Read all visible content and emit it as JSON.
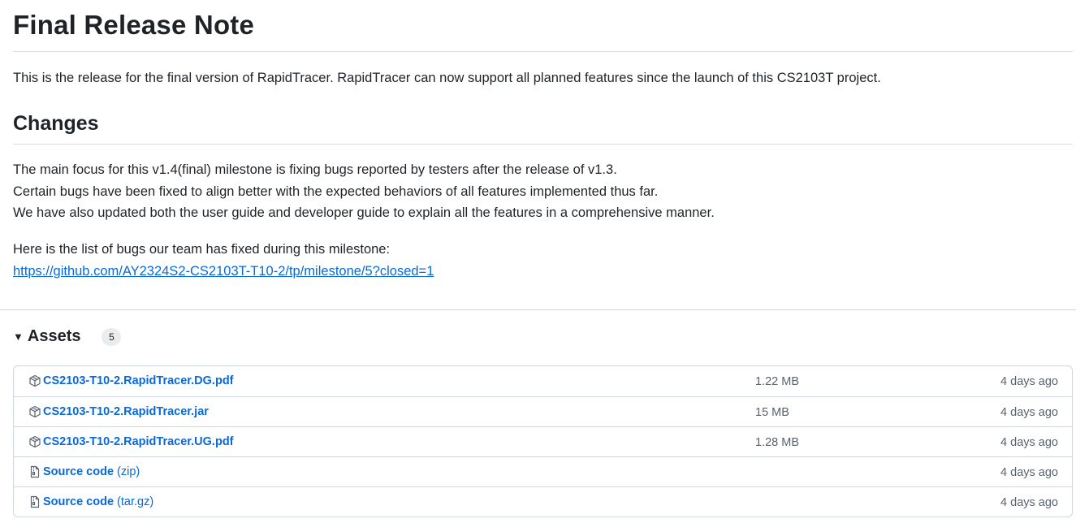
{
  "release": {
    "title": "Final Release Note",
    "intro": "This is the release for the final version of RapidTracer. RapidTracer can now support all planned features since the launch of this CS2103T project."
  },
  "changes": {
    "heading": "Changes",
    "lines": [
      "The main focus for this v1.4(final) milestone is fixing bugs reported by testers after the release of v1.3.",
      "Certain bugs have been fixed to align better with the expected behaviors of all features implemented thus far.",
      "We have also updated both the user guide and developer guide to explain all the features in a comprehensive manner."
    ],
    "bugs_intro": "Here is the list of bugs our team has fixed during this milestone:",
    "bugs_link": "https://github.com/AY2324S2-CS2103T-T10-2/tp/milestone/5?closed=1"
  },
  "assets": {
    "title": "Assets",
    "count": "5",
    "items": [
      {
        "icon": "package-icon",
        "name": "CS2103-T10-2.RapidTracer.DG.pdf",
        "ext": "",
        "size": "1.22 MB",
        "date": "4 days ago"
      },
      {
        "icon": "package-icon",
        "name": "CS2103-T10-2.RapidTracer.jar",
        "ext": "",
        "size": "15 MB",
        "date": "4 days ago"
      },
      {
        "icon": "package-icon",
        "name": "CS2103-T10-2.RapidTracer.UG.pdf",
        "ext": "",
        "size": "1.28 MB",
        "date": "4 days ago"
      },
      {
        "icon": "file-zip-icon",
        "name": "Source code",
        "ext": " (zip)",
        "size": "",
        "date": "4 days ago"
      },
      {
        "icon": "file-zip-icon",
        "name": "Source code",
        "ext": " (tar.gz)",
        "size": "",
        "date": "4 days ago"
      }
    ]
  }
}
